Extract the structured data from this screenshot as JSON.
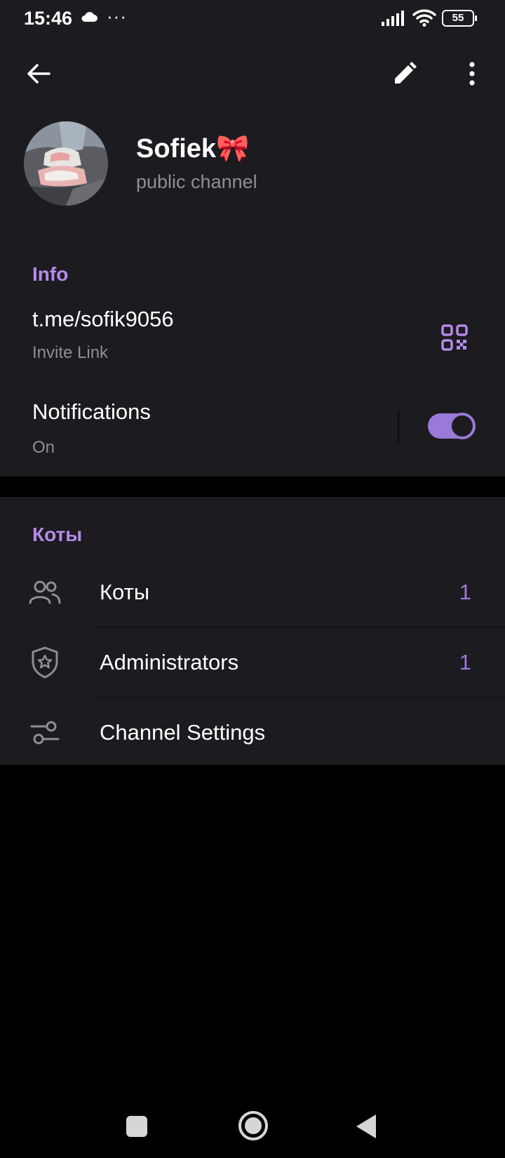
{
  "status_bar": {
    "time": "15:46",
    "dots": "···",
    "battery": "55",
    "icons": [
      "cloud-icon",
      "signal-icon",
      "wifi-icon",
      "battery-icon"
    ]
  },
  "header": {
    "title": "Sofiek🎀",
    "subtitle": "public channel",
    "actions": [
      "back-arrow-icon",
      "pencil-icon",
      "more-vertical-icon"
    ]
  },
  "info_section": {
    "title": "Info",
    "link": {
      "value": "t.me/sofik9056",
      "caption": "Invite Link",
      "icon": "qr-code-icon"
    },
    "notifications": {
      "label": "Notifications",
      "status": "On",
      "enabled": true
    }
  },
  "members_section": {
    "title": "Коты",
    "rows": [
      {
        "label": "Коты",
        "count": "1",
        "icon": "people-icon"
      },
      {
        "label": "Administrators",
        "count": "1",
        "icon": "shield-star-icon"
      },
      {
        "label": "Channel Settings",
        "count": "",
        "icon": "sliders-icon"
      }
    ]
  },
  "colors": {
    "background": "#000000",
    "surface": "#1c1b20",
    "accent": "#b58ae8",
    "toggle": "#9a7ad8",
    "secondary_text": "#8f8d96"
  }
}
